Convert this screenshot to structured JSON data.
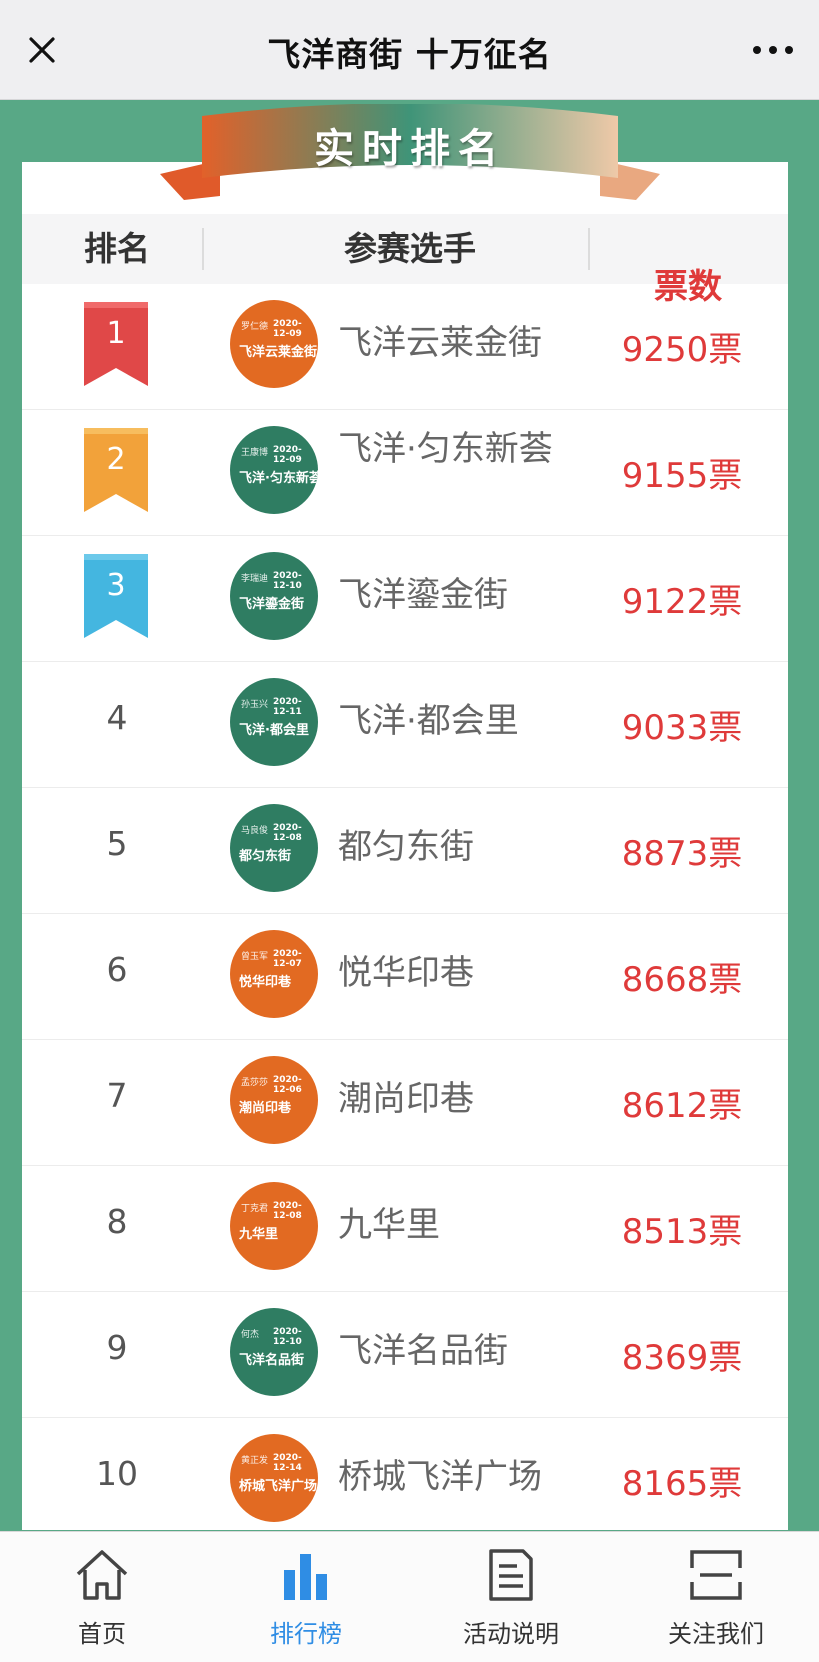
{
  "header": {
    "title": "飞洋商街 十万征名"
  },
  "banner": {
    "title": "实时排名"
  },
  "table": {
    "headers": {
      "rank": "排名",
      "player": "参赛选手",
      "votes": "票数"
    },
    "rows": [
      {
        "rank": "1",
        "name": "飞洋云莱金街",
        "votes": "9250票",
        "avatar": {
          "color": "#e26a22",
          "author": "罗仁德",
          "date": "2020-12-09",
          "text": "飞洋云莱金街"
        }
      },
      {
        "rank": "2",
        "name": "飞洋·匀东新荟",
        "votes": "9155票",
        "avatar": {
          "color": "#2f7d62",
          "author": "王康博",
          "date": "2020-12-09",
          "text": "飞洋·匀东新荟"
        }
      },
      {
        "rank": "3",
        "name": "飞洋鎏金街",
        "votes": "9122票",
        "avatar": {
          "color": "#2f7d62",
          "author": "李瑞迪",
          "date": "2020-12-10",
          "text": "飞洋鎏金街"
        }
      },
      {
        "rank": "4",
        "name": "飞洋·都会里",
        "votes": "9033票",
        "avatar": {
          "color": "#2f7d62",
          "author": "孙玉兴",
          "date": "2020-12-11",
          "text": "飞洋·都会里"
        }
      },
      {
        "rank": "5",
        "name": "都匀东街",
        "votes": "8873票",
        "avatar": {
          "color": "#2f7d62",
          "author": "马良俊",
          "date": "2020-12-08",
          "text": "都匀东街"
        }
      },
      {
        "rank": "6",
        "name": "悦华印巷",
        "votes": "8668票",
        "avatar": {
          "color": "#e26a22",
          "author": "曾玉军",
          "date": "2020-12-07",
          "text": "悦华印巷"
        }
      },
      {
        "rank": "7",
        "name": "潮尚印巷",
        "votes": "8612票",
        "avatar": {
          "color": "#e26a22",
          "author": "孟莎莎",
          "date": "2020-12-06",
          "text": "潮尚印巷"
        }
      },
      {
        "rank": "8",
        "name": "九华里",
        "votes": "8513票",
        "avatar": {
          "color": "#e26a22",
          "author": "丁克君",
          "date": "2020-12-08",
          "text": "九华里"
        }
      },
      {
        "rank": "9",
        "name": "飞洋名品街",
        "votes": "8369票",
        "avatar": {
          "color": "#2f7d62",
          "author": "何杰",
          "date": "2020-12-10",
          "text": "飞洋名品街"
        }
      },
      {
        "rank": "10",
        "name": "桥城飞洋广场",
        "votes": "8165票",
        "avatar": {
          "color": "#e26a22",
          "author": "黄正发",
          "date": "2020-12-14",
          "text": "桥城飞洋广场"
        }
      }
    ]
  },
  "tabbar": {
    "items": [
      {
        "label": "首页",
        "icon": "home-icon"
      },
      {
        "label": "排行榜",
        "icon": "bar-chart-icon",
        "active": true
      },
      {
        "label": "活动说明",
        "icon": "document-icon"
      },
      {
        "label": "关注我们",
        "icon": "frame-icon"
      }
    ]
  },
  "colors": {
    "background": "#58a886",
    "votes": "#df3a3a",
    "active_tab": "#2f8de4",
    "rank1": "#e04848",
    "rank2": "#f2a23a",
    "rank3": "#44b6e0"
  }
}
